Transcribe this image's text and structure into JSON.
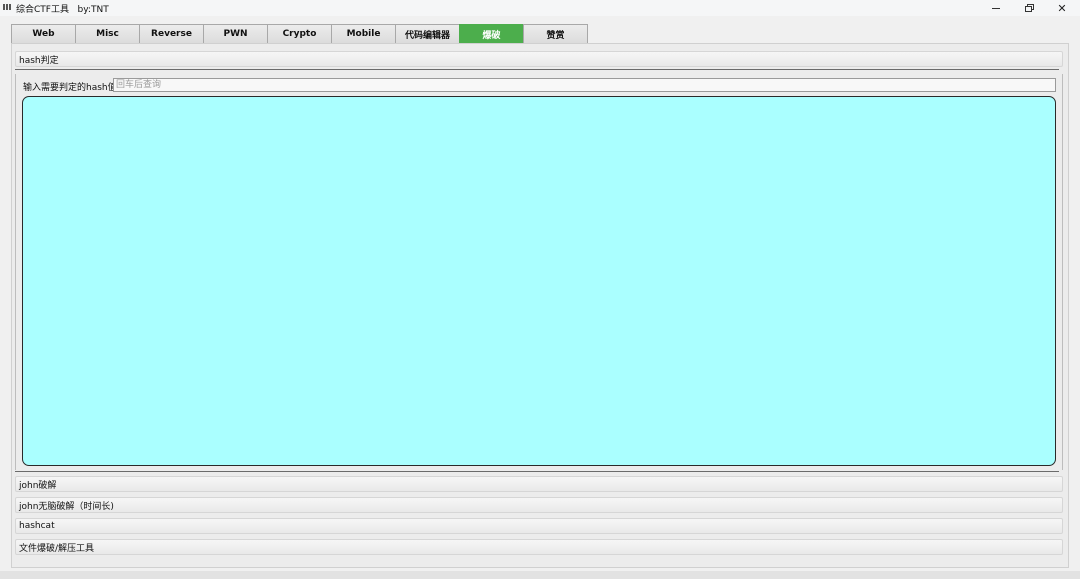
{
  "window": {
    "title": "综合CTF工具   by:TNT",
    "controls": {
      "minimize": "minimize",
      "maximize": "restore",
      "close": "✕"
    }
  },
  "tabs": [
    {
      "label": "Web"
    },
    {
      "label": "Misc"
    },
    {
      "label": "Reverse"
    },
    {
      "label": "PWN"
    },
    {
      "label": "Crypto"
    },
    {
      "label": "Mobile"
    },
    {
      "label": "代码编辑器"
    },
    {
      "label": "爆破",
      "active": true
    },
    {
      "label": "赞赏"
    }
  ],
  "accent_color": "#4cae4c",
  "sections": {
    "hash": {
      "header": "hash判定",
      "input_label": "输入需要判定的hash值",
      "input_placeholder": "回车后查询",
      "input_value": "",
      "output_value": "",
      "output_bg": "#aaffff"
    },
    "collapsed": [
      {
        "header": "john破解"
      },
      {
        "header": "john无脑破解（时间长)"
      },
      {
        "header": "hashcat"
      },
      {
        "header": "文件爆破/解压工具"
      }
    ]
  }
}
